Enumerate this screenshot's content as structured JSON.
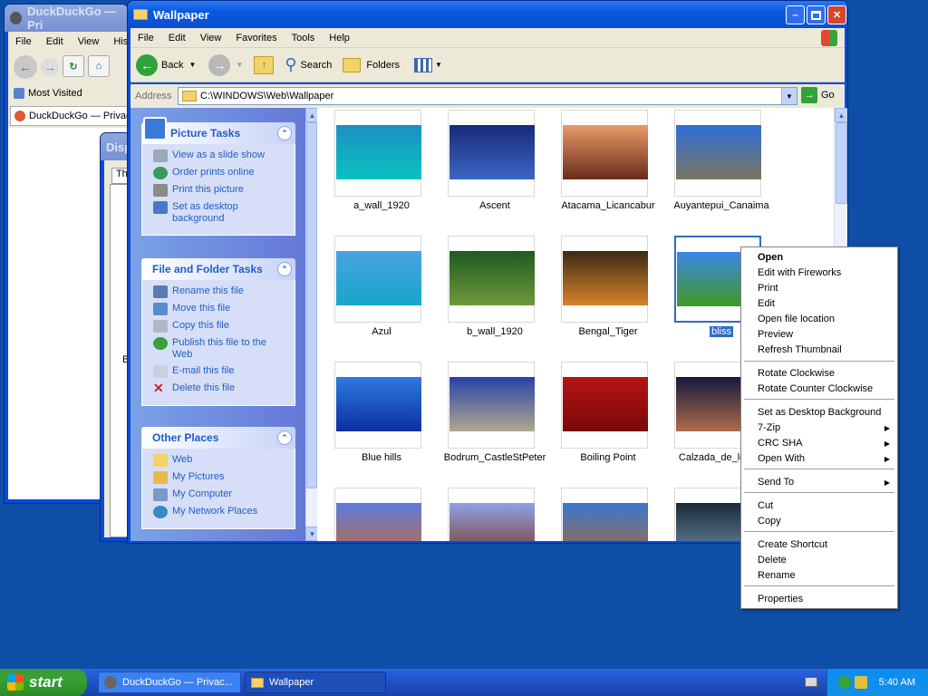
{
  "firefox": {
    "title": "DuckDuckGo — Pri",
    "menu": [
      "File",
      "Edit",
      "View",
      "Histo"
    ],
    "bookmark": "Most Visited",
    "tab": "DuckDuckGo — Privacy"
  },
  "display_dialog": {
    "title": "Disp",
    "tab": "Th",
    "label": "B"
  },
  "explorer": {
    "title": "Wallpaper",
    "menu": [
      "File",
      "Edit",
      "View",
      "Favorites",
      "Tools",
      "Help"
    ],
    "toolbar": {
      "back": "Back",
      "search": "Search",
      "folders": "Folders"
    },
    "address_label": "Address",
    "address_value": "C:\\WINDOWS\\Web\\Wallpaper",
    "go_label": "Go",
    "picture_tasks": {
      "title": "Picture Tasks",
      "items": [
        "View as a slide show",
        "Order prints online",
        "Print this picture",
        "Set as desktop background"
      ]
    },
    "file_folder_tasks": {
      "title": "File and Folder Tasks",
      "items": [
        "Rename this file",
        "Move this file",
        "Copy this file",
        "Publish this file to the Web",
        "E-mail this file",
        "Delete this file"
      ]
    },
    "other_places": {
      "title": "Other Places",
      "items": [
        "Web",
        "My Pictures",
        "My Computer",
        "My Network Places"
      ]
    },
    "files": [
      {
        "name": "a_wall_1920",
        "c1": "#1b8fc4",
        "c2": "#0ac2c0"
      },
      {
        "name": "Ascent",
        "c1": "#182a78",
        "c2": "#3b66c4"
      },
      {
        "name": "Atacama_Licancabur",
        "c1": "#e89a6a",
        "c2": "#6b2b1a"
      },
      {
        "name": "Auyantepui_Canaima",
        "c1": "#2e6fd8",
        "c2": "#7b7561"
      },
      {
        "name": "Azul",
        "c1": "#4aa2e4",
        "c2": "#18a6c8"
      },
      {
        "name": "b_wall_1920",
        "c1": "#1d5a22",
        "c2": "#6e9a3c"
      },
      {
        "name": "Bengal_Tiger",
        "c1": "#3a2a14",
        "c2": "#d8822a"
      },
      {
        "name": "bliss",
        "c1": "#3a86e8",
        "c2": "#3f9a22"
      },
      {
        "name": "Blue hills",
        "c1": "#2e7ae0",
        "c2": "#0c2f9e"
      },
      {
        "name": "Bodrum_CastleStPeter",
        "c1": "#2842a8",
        "c2": "#b0a890"
      },
      {
        "name": "Boiling Point",
        "c1": "#b51414",
        "c2": "#7a0808"
      },
      {
        "name": "Calzada_de_los_M",
        "c1": "#141a3c",
        "c2": "#b06a4c"
      },
      {
        "name": "",
        "c1": "#5a7ce0",
        "c2": "#c26a3a"
      },
      {
        "name": "",
        "c1": "#8ea2e6",
        "c2": "#7a3a2a"
      },
      {
        "name": "",
        "c1": "#3a78d0",
        "c2": "#a06a3a"
      },
      {
        "name": "",
        "c1": "#1a2a3a",
        "c2": "#6a8aa0"
      }
    ]
  },
  "context_menu": {
    "items": [
      "Open",
      "Edit with Fireworks",
      "Print",
      "Edit",
      "Open file location",
      "Preview",
      "Refresh Thumbnail",
      "Rotate Clockwise",
      "Rotate Counter Clockwise",
      "Set as Desktop Background",
      "7-Zip",
      "CRC SHA",
      "Open With",
      "Send To",
      "Cut",
      "Copy",
      "Create Shortcut",
      "Delete",
      "Rename",
      "Properties"
    ]
  },
  "taskbar": {
    "start": "start",
    "tasks": [
      "DuckDuckGo — Privac...",
      "Wallpaper"
    ],
    "clock": "5:40 AM"
  }
}
